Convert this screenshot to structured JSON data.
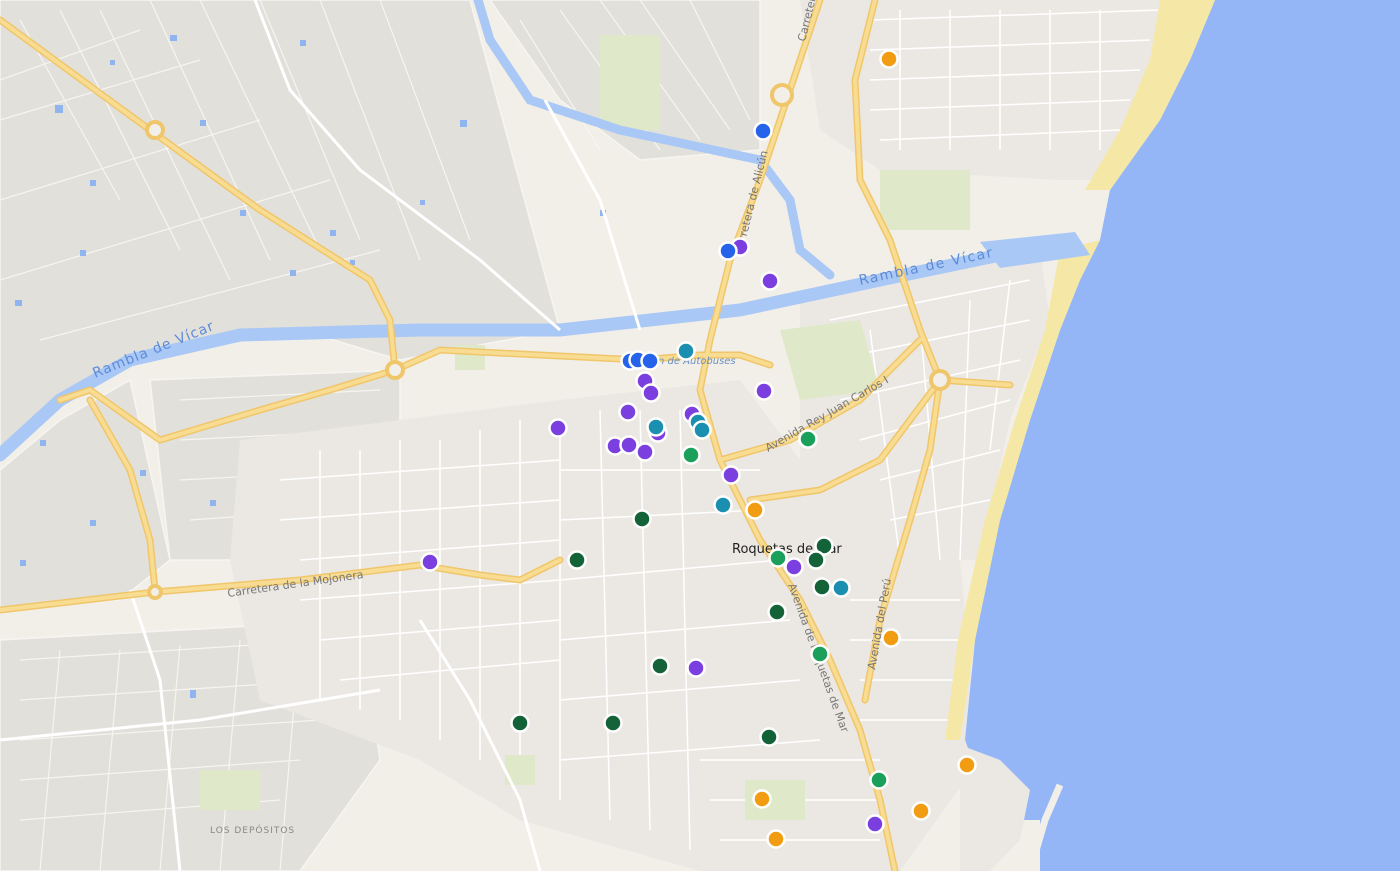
{
  "map": {
    "labels": {
      "city": "Roquetas de Mar",
      "rambla_1": "Rambla de Vícar",
      "rambla_2": "Rambla de Vícar",
      "bus_station": "Estación de Autobuses",
      "ctra_alicun": "Carretera de Alicún",
      "ctra_top": "Carretera",
      "av_rey": "Avenida Rey Juan Carlos I",
      "ctra_mojonera": "Carretera de la Mojonera",
      "av_roquetas": "Avenida de Roquetas de Mar",
      "av_peru": "Avenida del Perú",
      "depositos": "LOS DEPÓSITOS"
    },
    "colors": {
      "land": "#f2efe9",
      "fields": "#e3e1dc",
      "water": "#94b6f7",
      "canal": "#a9c8f5",
      "beach": "#f5e8a8",
      "major_road": "#f7d27a",
      "minor_road": "#ffffff",
      "park": "#dde8c8",
      "marker_purple": "#7b3fe0",
      "marker_blue": "#2563eb",
      "marker_teal": "#1a8fb0",
      "marker_green": "#1aa05a",
      "marker_darkgreen": "#136238",
      "marker_orange": "#f29c12",
      "marker_red": "#e02626"
    },
    "markers": [
      {
        "category": "purple",
        "icon": "map-pin-icon"
      },
      {
        "category": "purple",
        "icon": "map-pin-icon"
      },
      {
        "category": "purple",
        "icon": "map-pin-icon"
      },
      {
        "category": "purple",
        "icon": "map-pin-icon"
      },
      {
        "category": "purple",
        "icon": "map-pin-icon"
      },
      {
        "category": "purple",
        "icon": "map-pin-icon"
      },
      {
        "category": "purple",
        "icon": "map-pin-icon"
      },
      {
        "category": "purple",
        "icon": "map-pin-icon"
      },
      {
        "category": "purple",
        "icon": "map-pin-icon"
      },
      {
        "category": "purple",
        "icon": "map-pin-icon"
      },
      {
        "category": "purple",
        "icon": "map-pin-icon"
      },
      {
        "category": "purple",
        "icon": "map-pin-icon"
      },
      {
        "category": "purple",
        "icon": "map-pin-icon"
      },
      {
        "category": "purple",
        "icon": "map-pin-icon"
      },
      {
        "category": "purple",
        "icon": "map-pin-icon"
      },
      {
        "category": "purple",
        "icon": "map-pin-icon"
      },
      {
        "category": "purple",
        "icon": "map-pin-icon"
      },
      {
        "category": "blue",
        "icon": "map-pin-icon"
      },
      {
        "category": "blue",
        "icon": "map-pin-icon"
      },
      {
        "category": "blue",
        "icon": "map-pin-icon"
      },
      {
        "category": "blue",
        "icon": "map-pin-icon"
      },
      {
        "category": "blue",
        "icon": "map-pin-icon"
      },
      {
        "category": "teal",
        "icon": "map-pin-icon"
      },
      {
        "category": "teal",
        "icon": "map-pin-icon"
      },
      {
        "category": "teal",
        "icon": "map-pin-icon"
      },
      {
        "category": "teal",
        "icon": "map-pin-icon"
      },
      {
        "category": "teal",
        "icon": "map-pin-icon"
      },
      {
        "category": "teal",
        "icon": "map-pin-icon"
      },
      {
        "category": "green",
        "icon": "map-pin-icon"
      },
      {
        "category": "green",
        "icon": "map-pin-icon"
      },
      {
        "category": "green",
        "icon": "map-pin-icon"
      },
      {
        "category": "green",
        "icon": "map-pin-icon"
      },
      {
        "category": "green",
        "icon": "map-pin-icon"
      },
      {
        "category": "darkgreen",
        "icon": "map-pin-icon"
      },
      {
        "category": "darkgreen",
        "icon": "map-pin-icon"
      },
      {
        "category": "darkgreen",
        "icon": "map-pin-icon"
      },
      {
        "category": "darkgreen",
        "icon": "map-pin-icon"
      },
      {
        "category": "darkgreen",
        "icon": "map-pin-icon"
      },
      {
        "category": "darkgreen",
        "icon": "map-pin-icon"
      },
      {
        "category": "darkgreen",
        "icon": "map-pin-icon"
      },
      {
        "category": "darkgreen",
        "icon": "map-pin-icon"
      },
      {
        "category": "darkgreen",
        "icon": "map-pin-icon"
      },
      {
        "category": "darkgreen",
        "icon": "map-pin-icon"
      },
      {
        "category": "orange",
        "icon": "map-pin-icon"
      },
      {
        "category": "orange",
        "icon": "map-pin-icon"
      },
      {
        "category": "orange",
        "icon": "map-pin-icon"
      },
      {
        "category": "orange",
        "icon": "map-pin-icon"
      },
      {
        "category": "orange",
        "icon": "map-pin-icon"
      },
      {
        "category": "orange",
        "icon": "map-pin-icon"
      },
      {
        "category": "orange",
        "icon": "map-pin-icon"
      },
      {
        "category": "orange",
        "icon": "map-pin-icon"
      },
      {
        "category": "red",
        "icon": "map-pin-icon"
      }
    ]
  }
}
